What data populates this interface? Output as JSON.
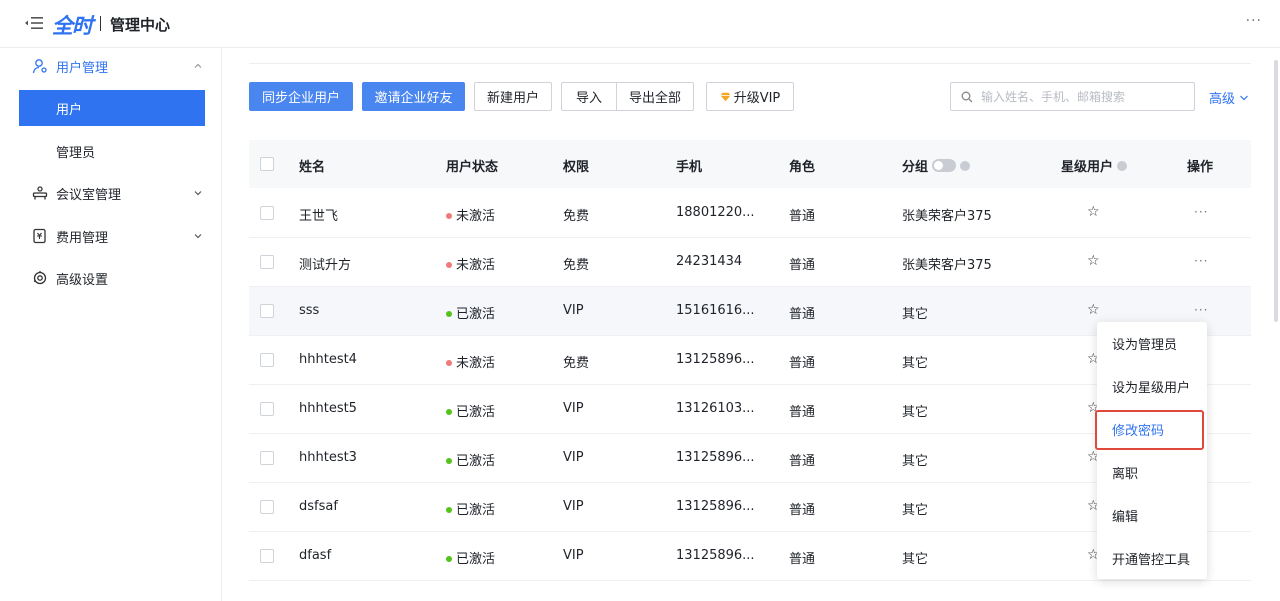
{
  "header": {
    "logo": "全时",
    "title": "管理中心",
    "more": "···"
  },
  "sidebar": {
    "items": [
      {
        "label": "用户管理",
        "icon": "user-manage-icon"
      },
      {
        "label": "用户"
      },
      {
        "label": "管理员"
      },
      {
        "label": "会议室管理",
        "icon": "meeting-room-icon"
      },
      {
        "label": "费用管理",
        "icon": "fee-icon"
      },
      {
        "label": "高级设置",
        "icon": "advanced-settings-icon"
      }
    ]
  },
  "toolbar": {
    "sync_label": "同步企业用户",
    "invite_label": "邀请企业好友",
    "new_user_label": "新建用户",
    "import_label": "导入",
    "export_label": "导出全部",
    "upgrade_label": "升级VIP",
    "search_placeholder": "输入姓名、手机、邮箱搜索",
    "advanced_label": "高级"
  },
  "table": {
    "headers": {
      "name": "姓名",
      "status": "用户状态",
      "permission": "权限",
      "phone": "手机",
      "role": "角色",
      "group": "分组",
      "star": "星级用户",
      "action": "操作"
    },
    "rows": [
      {
        "name": "王世飞",
        "status": "未激活",
        "permission": "免费",
        "phone": "18801220...",
        "role": "普通",
        "group": "张美荣客户375"
      },
      {
        "name": "测试升方",
        "status": "未激活",
        "permission": "免费",
        "phone": "24231434",
        "role": "普通",
        "group": "张美荣客户375"
      },
      {
        "name": "sss",
        "status": "已激活",
        "permission": "VIP",
        "phone": "15161616...",
        "role": "普通",
        "group": "其它"
      },
      {
        "name": "hhhtest4",
        "status": "未激活",
        "permission": "免费",
        "phone": "13125896...",
        "role": "普通",
        "group": "其它"
      },
      {
        "name": "hhhtest5",
        "status": "已激活",
        "permission": "VIP",
        "phone": "13126103...",
        "role": "普通",
        "group": "其它"
      },
      {
        "name": "hhhtest3",
        "status": "已激活",
        "permission": "VIP",
        "phone": "13125896...",
        "role": "普通",
        "group": "其它"
      },
      {
        "name": "dsfsaf",
        "status": "已激活",
        "permission": "VIP",
        "phone": "13125896...",
        "role": "普通",
        "group": "其它"
      },
      {
        "name": "dfasf",
        "status": "已激活",
        "permission": "VIP",
        "phone": "13125896...",
        "role": "普通",
        "group": "其它"
      }
    ],
    "star_glyph": "☆",
    "more_glyph": "···"
  },
  "dropdown": {
    "items": [
      {
        "label": "设为管理员"
      },
      {
        "label": "设为星级用户"
      },
      {
        "label": "修改密码"
      },
      {
        "label": "离职"
      },
      {
        "label": "编辑"
      },
      {
        "label": "开通管控工具"
      }
    ]
  },
  "colors": {
    "primary": "#2f73f0",
    "inactive_dot": "#f07a7a",
    "active_dot": "#52c41a",
    "highlight_frame": "#e0483a"
  }
}
